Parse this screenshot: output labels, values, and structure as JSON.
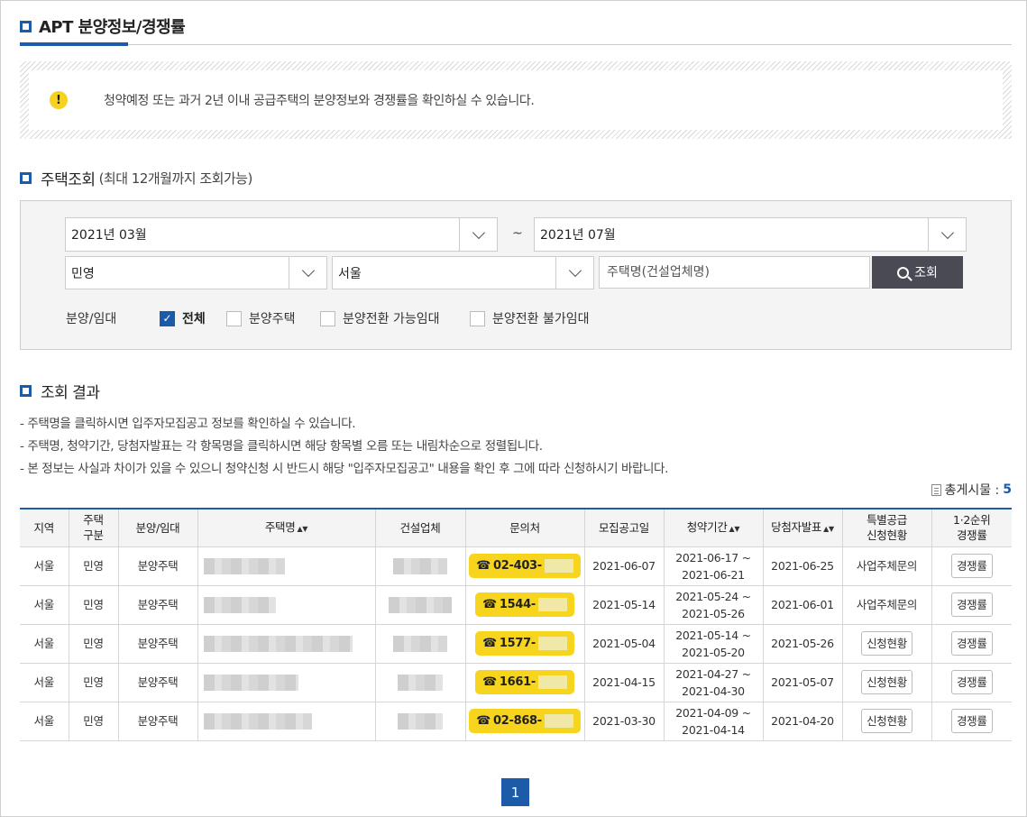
{
  "page_title": "APT 분양정보/경쟁률",
  "notice": "청약예정 또는 과거 2년 이내 공급주택의 분양정보와 경쟁률을 확인하실 수 있습니다.",
  "notice_icon": "!",
  "search": {
    "title": "주택조회",
    "subtitle": "(최대 12개월까지 조회가능)",
    "start_month": "2021년 03월",
    "tilde": "~",
    "end_month": "2021년 07월",
    "house_type": "민영",
    "region": "서울",
    "name_placeholder": "주택명(건설업체명)",
    "search_button": "조회",
    "type_label": "분양/임대",
    "options": [
      {
        "label": "전체",
        "checked": true
      },
      {
        "label": "분양주택",
        "checked": false
      },
      {
        "label": "분양전환 가능임대",
        "checked": false
      },
      {
        "label": "분양전환 불가임대",
        "checked": false
      }
    ]
  },
  "results": {
    "title": "조회 결과",
    "info": [
      "-  주택명을 클릭하시면 입주자모집공고 정보를 확인하실 수 있습니다.",
      "-  주택명, 청약기간, 당첨자발표는 각 항목명을 클릭하시면 해당 항목별 오름 또는 내림차순으로 정렬됩니다.",
      "-  본 정보는 사실과 차이가 있을 수 있으니 청약신청 시 반드시 해당 \"입주자모집공고\" 내용을 확인 후 그에 따라 신청하시기 바랍니다."
    ],
    "total_label": "총게시물 :",
    "total_count": "5",
    "columns": [
      "지역",
      "주택\n구분",
      "분양/임대",
      "주택명",
      "건설업체",
      "문의처",
      "모집공고일",
      "청약기간",
      "당첨자발표",
      "특별공급\n신청현황",
      "1·2순위\n경쟁률"
    ],
    "rows": [
      {
        "region": "서울",
        "type": "민영",
        "kind": "분양주택",
        "phone": "02-403-",
        "notice_date": "2021-06-07",
        "period_start": "2021-06-17 ~",
        "period_end": "2021-06-21",
        "winner": "2021-06-25",
        "special": "사업주체문의",
        "special_button": false,
        "compete": "경쟁률"
      },
      {
        "region": "서울",
        "type": "민영",
        "kind": "분양주택",
        "phone": "1544-",
        "notice_date": "2021-05-14",
        "period_start": "2021-05-24 ~",
        "period_end": "2021-05-26",
        "winner": "2021-06-01",
        "special": "사업주체문의",
        "special_button": false,
        "compete": "경쟁률"
      },
      {
        "region": "서울",
        "type": "민영",
        "kind": "분양주택",
        "phone": "1577-",
        "notice_date": "2021-05-04",
        "period_start": "2021-05-14 ~",
        "period_end": "2021-05-20",
        "winner": "2021-05-26",
        "special": "신청현황",
        "special_button": true,
        "compete": "경쟁률"
      },
      {
        "region": "서울",
        "type": "민영",
        "kind": "분양주택",
        "phone": "1661-",
        "notice_date": "2021-04-15",
        "period_start": "2021-04-27 ~",
        "period_end": "2021-04-30",
        "winner": "2021-05-07",
        "special": "신청현황",
        "special_button": true,
        "compete": "경쟁률"
      },
      {
        "region": "서울",
        "type": "민영",
        "kind": "분양주택",
        "phone": "02-868-",
        "notice_date": "2021-03-30",
        "period_start": "2021-04-09 ~",
        "period_end": "2021-04-14",
        "winner": "2021-04-20",
        "special": "신청현황",
        "special_button": true,
        "compete": "경쟁률"
      }
    ]
  },
  "pagination": {
    "current": "1"
  }
}
